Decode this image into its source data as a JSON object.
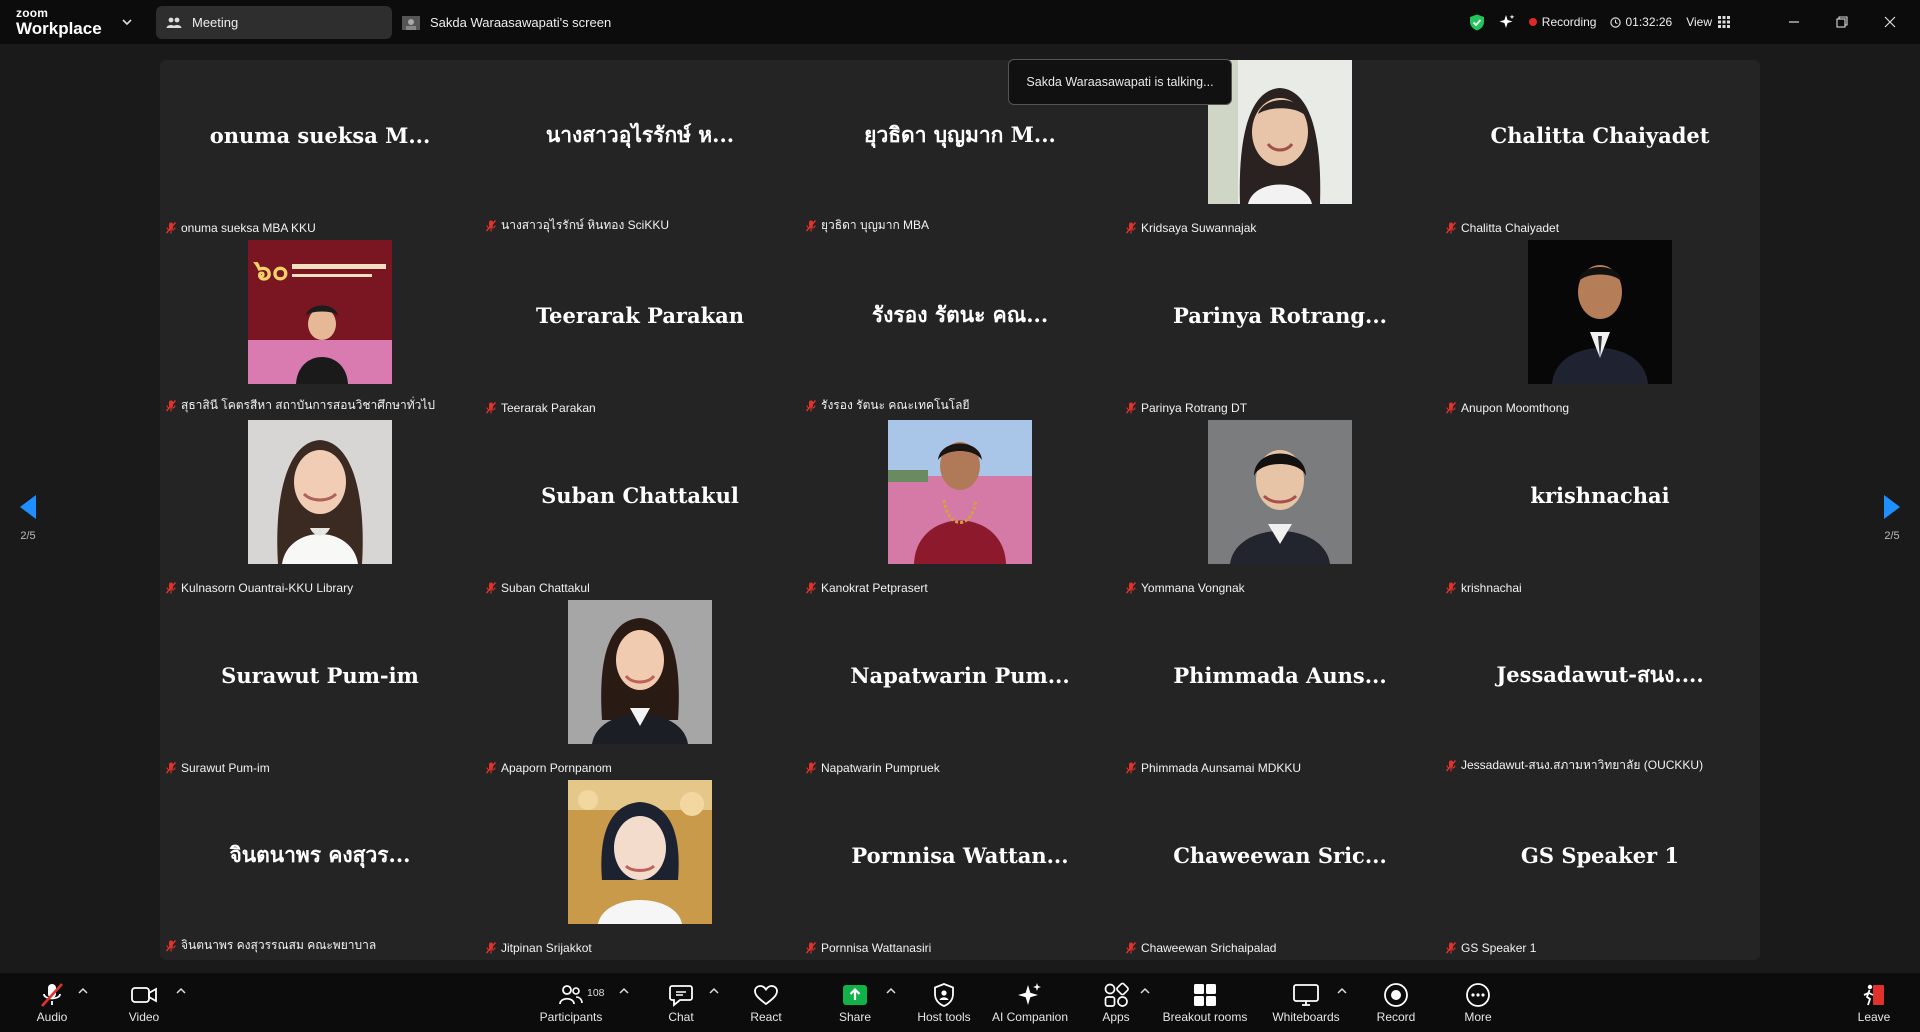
{
  "app": {
    "brand_top": "zoom",
    "brand_bottom": "Workplace"
  },
  "tabs": {
    "meeting": "Meeting",
    "screen": "Sakda Waraasawapati's screen"
  },
  "status": {
    "recording": "Recording",
    "timer": "01:32:26",
    "view": "View"
  },
  "toast": "Sakda Waraasawapati is talking...",
  "pager": {
    "left": "2/5",
    "right": "2/5"
  },
  "participants": [
    {
      "big": "onuma  sueksa  M...",
      "label": "onuma sueksa MBA KKU",
      "photo": null
    },
    {
      "big": "นางสาวอุไรรักษ์ ห...",
      "label": "นางสาวอุไรรักษ์ หินทอง SciKKU",
      "photo": null
    },
    {
      "big": "ยุวธิดา บุญมาก M...",
      "label": "ยุวธิดา บุญมาก MBA",
      "photo": null
    },
    {
      "big": "",
      "label": "Kridsaya Suwannajak",
      "photo": "woman-light"
    },
    {
      "big": "Chalitta Chaiyadet",
      "label": "Chalitta Chaiyadet",
      "photo": null
    },
    {
      "big": "",
      "label": "สุธาสินี โคตรสีหา สถาบันการสอนวิชาศึกษาทั่วไป",
      "photo": "event-stage"
    },
    {
      "big": "Teerarak Parakan",
      "label": "Teerarak Parakan",
      "photo": null
    },
    {
      "big": "รังรอง  รัตนะ คณ...",
      "label": "รังรอง  รัตนะ คณะเทคโนโลยี",
      "photo": null
    },
    {
      "big": "Parinya  Rotrang...",
      "label": "Parinya Rotrang DT",
      "photo": null
    },
    {
      "big": "",
      "label": "Anupon Moomthong",
      "photo": "man-suit"
    },
    {
      "big": "",
      "label": "Kulnasorn Ouantrai-KKU Library",
      "photo": "woman-white"
    },
    {
      "big": "Suban Chattakul",
      "label": "Suban Chattakul",
      "photo": null
    },
    {
      "big": "",
      "label": "Kanokrat Petprasert",
      "photo": "woman-outdoor"
    },
    {
      "big": "",
      "label": "Yommana Vongnak",
      "photo": "woman-formal"
    },
    {
      "big": "krishnachai",
      "label": "krishnachai",
      "photo": null
    },
    {
      "big": "Surawut Pum-im",
      "label": "Surawut Pum-im",
      "photo": null
    },
    {
      "big": "",
      "label": "Apaporn Pornpanom",
      "photo": "woman-portrait"
    },
    {
      "big": "Napatwarin  Pum...",
      "label": "Napatwarin Pumpruek",
      "photo": null
    },
    {
      "big": "Phimmada  Auns...",
      "label": "Phimmada Aunsamai MDKKU",
      "photo": null
    },
    {
      "big": "Jessadawut-สนง....",
      "label": "Jessadawut-สนง.สภามหาวิทยาลัย (OUCKKU)",
      "photo": null
    },
    {
      "big": "จินตนาพร คงสุวร...",
      "label": "จินตนาพร คงสุวรรณสม คณะพยาบาล",
      "photo": null
    },
    {
      "big": "",
      "label": "Jitpinan Srijakkot",
      "photo": "woman-gold"
    },
    {
      "big": "Pornnisa  Wattan...",
      "label": "Pornnisa Wattanasiri",
      "photo": null
    },
    {
      "big": "Chaweewan  Sric...",
      "label": "Chaweewan Srichaipalad",
      "photo": null
    },
    {
      "big": "GS Speaker 1",
      "label": "GS Speaker 1",
      "photo": null
    }
  ],
  "toolbar": {
    "audio": "Audio",
    "video": "Video",
    "participants": "Participants",
    "participants_count": "108",
    "chat": "Chat",
    "react": "React",
    "share": "Share",
    "host_tools": "Host tools",
    "ai_companion": "AI Companion",
    "apps": "Apps",
    "breakout_rooms": "Breakout rooms",
    "whiteboards": "Whiteboards",
    "record": "Record",
    "more": "More",
    "leave": "Leave"
  },
  "colors": {
    "share_green": "#12b24a",
    "muted_red": "#e0322c",
    "accent_blue": "#1f8fff"
  }
}
